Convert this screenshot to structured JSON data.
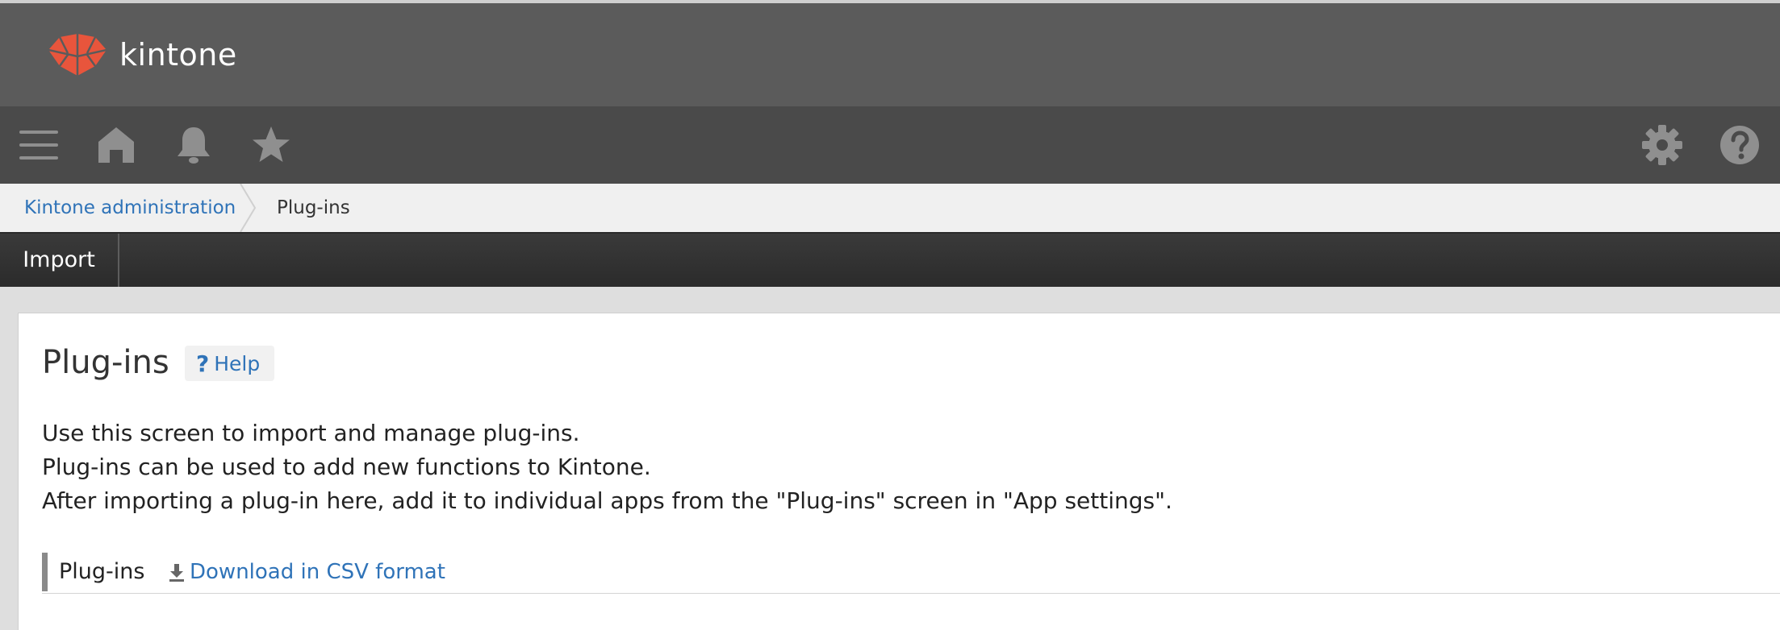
{
  "header": {
    "logo_text": "kintone"
  },
  "navbar": {
    "icons": [
      "menu-icon",
      "home-icon",
      "bell-icon",
      "star-icon",
      "gear-icon",
      "help-circle-icon"
    ]
  },
  "breadcrumb": {
    "parent": "Kintone administration",
    "current": "Plug-ins"
  },
  "toolbar": {
    "import_label": "Import"
  },
  "main": {
    "title": "Plug-ins",
    "help_icon": "?",
    "help_label": "Help",
    "description": [
      "Use this screen to import and manage plug-ins.",
      "Plug-ins can be used to add new functions to Kintone.",
      "After importing a plug-in here, add it to individual apps from the \"Plug-ins\" screen in \"App settings\"."
    ],
    "section": {
      "label": "Plug-ins",
      "download_label": "Download in CSV format"
    }
  },
  "colors": {
    "header_bg": "#5b5b5b",
    "navbar_bg": "#4a4a4a",
    "logo_red": "#e8553c",
    "link_blue": "#2f73b8",
    "icon_gray": "#8f8f8f"
  }
}
